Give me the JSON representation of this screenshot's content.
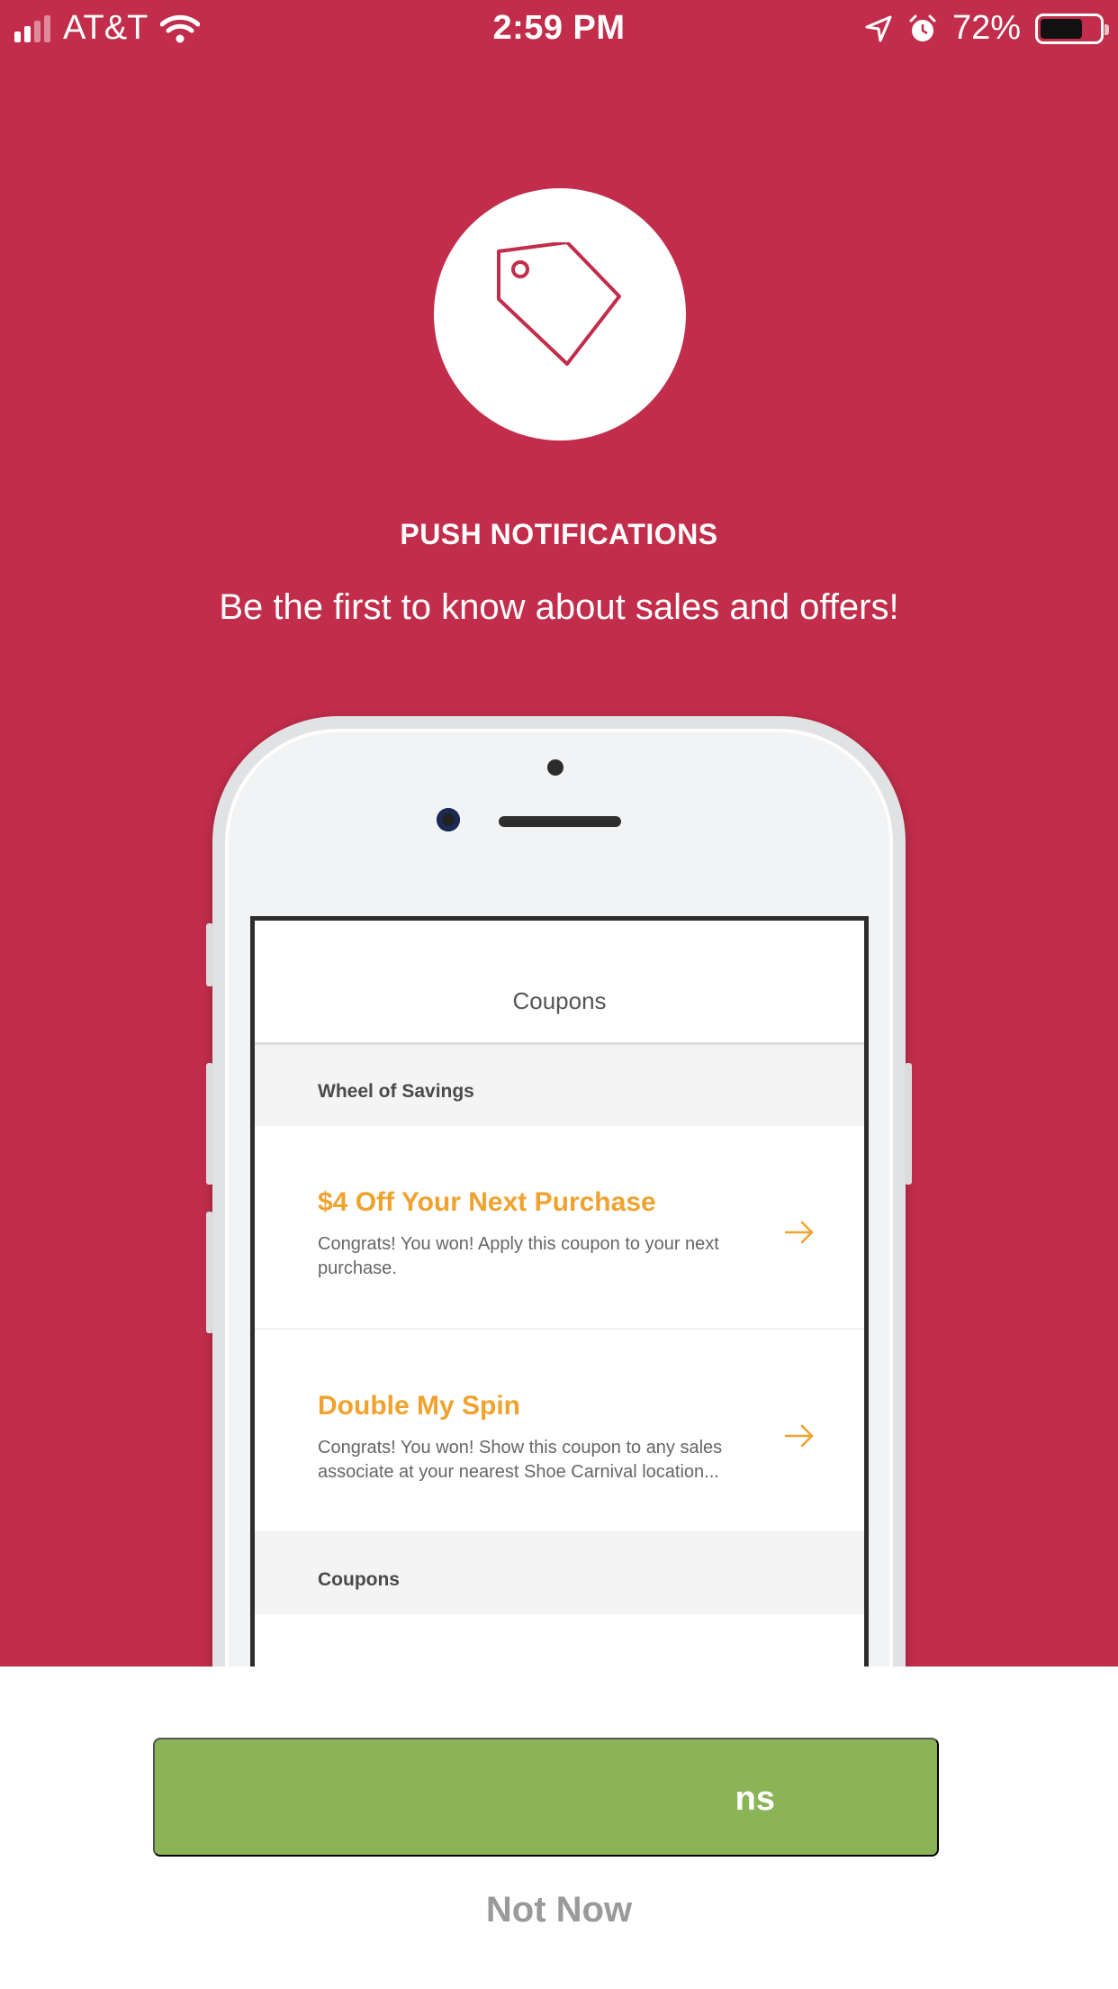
{
  "status_bar": {
    "carrier": "AT&T",
    "time": "2:59 PM",
    "battery_percent": "72%",
    "battery_level": 0.72,
    "icons": [
      "signal-icon",
      "wifi-icon",
      "location-icon",
      "alarm-icon",
      "battery-icon"
    ]
  },
  "hero": {
    "icon": "price-tag-icon",
    "title": "PUSH NOTIFICATIONS",
    "subtitle": "Be the first to know about sales and offers!"
  },
  "phone_preview": {
    "screen_title": "Coupons",
    "sections": [
      {
        "header": "Wheel of Savings",
        "items": [
          {
            "title": "$4 Off Your Next Purchase",
            "description": "Congrats! You won! Apply this coupon to your next purchase."
          },
          {
            "title": "Double My Spin",
            "description": "Congrats! You won! Show this coupon to any sales associate at your nearest Shoe Carnival location..."
          }
        ]
      },
      {
        "header": "Coupons",
        "items": []
      }
    ]
  },
  "actions": {
    "primary_label": "ns",
    "secondary_label": "Not Now"
  },
  "colors": {
    "background": "#c12d4a",
    "accent_green": "#8bb456",
    "coupon_orange": "#f0a22e"
  }
}
